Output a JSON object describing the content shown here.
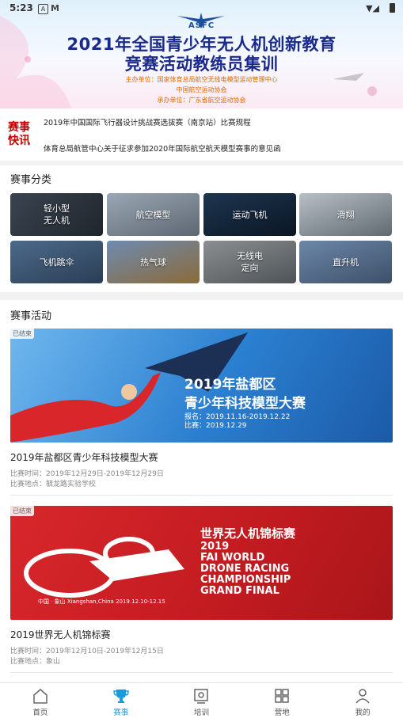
{
  "status_bar": {
    "time": "5:23",
    "icons": [
      "a-icon",
      "m-icon",
      "wifi-icon",
      "signal-icon",
      "battery-icon"
    ]
  },
  "banner": {
    "logo_text": "ASFC",
    "title_line1": "2021年全国青少年无人机创新教育",
    "title_line2": "竞赛活动教练员集训",
    "sub1": "主办单位：国家体育总局航空无线电模型运动管理中心",
    "sub2": "中国航空运动协会",
    "sub3": "承办单位：广东省航空运动协会"
  },
  "news": {
    "badge": "赛事\n快讯",
    "items": [
      "2019年中国国际飞行器设计挑战赛选拔赛（南京站）比赛规程",
      "体育总局航管中心关于征求参加2020年国际航空航天模型赛事的意见函"
    ]
  },
  "categories": {
    "title": "赛事分类",
    "items": [
      {
        "label": "轻小型\n无人机"
      },
      {
        "label": "航空模型"
      },
      {
        "label": "运动飞机"
      },
      {
        "label": "滑翔"
      },
      {
        "label": "飞机跳伞"
      },
      {
        "label": "热气球"
      },
      {
        "label": "无线电\n定向"
      },
      {
        "label": "直升机"
      }
    ]
  },
  "activities": {
    "title": "赛事活动",
    "items": [
      {
        "badge": "已结束",
        "banner_line1": "2019年盐都区",
        "banner_line2": "青少年科技模型大赛",
        "banner_line3": "报名：2019.11.16-2019.12.22",
        "banner_line4": "比赛：2019.12.29",
        "title": "2019年盐都区青少年科技模型大赛",
        "time": "比赛时间：2019年12月29日-2019年12月29日",
        "place": "比赛地点：毓龙路实验学校"
      },
      {
        "badge": "已结束",
        "banner_line1": "世界无人机锦标赛",
        "banner_line2": "2019",
        "banner_line3": "FAI WORLD",
        "banner_line4": "DRONE RACING",
        "banner_line5": "CHAMPIONSHIP",
        "banner_line6": "GRAND FINAL",
        "banner_footer": "中国 · 象山 Xiangshan,China 2019.12.10-12.15",
        "title": "2019世界无人机锦标赛",
        "time": "比赛时间：2019年12月10日-2019年12月15日",
        "place": "比赛地点：象山"
      }
    ]
  },
  "tabbar": {
    "items": [
      {
        "label": "首页",
        "icon": "home-icon"
      },
      {
        "label": "赛事",
        "icon": "trophy-icon"
      },
      {
        "label": "培训",
        "icon": "training-icon"
      },
      {
        "label": "营地",
        "icon": "camp-icon"
      },
      {
        "label": "我的",
        "icon": "profile-icon"
      }
    ],
    "active_color": "#1a9be0"
  }
}
